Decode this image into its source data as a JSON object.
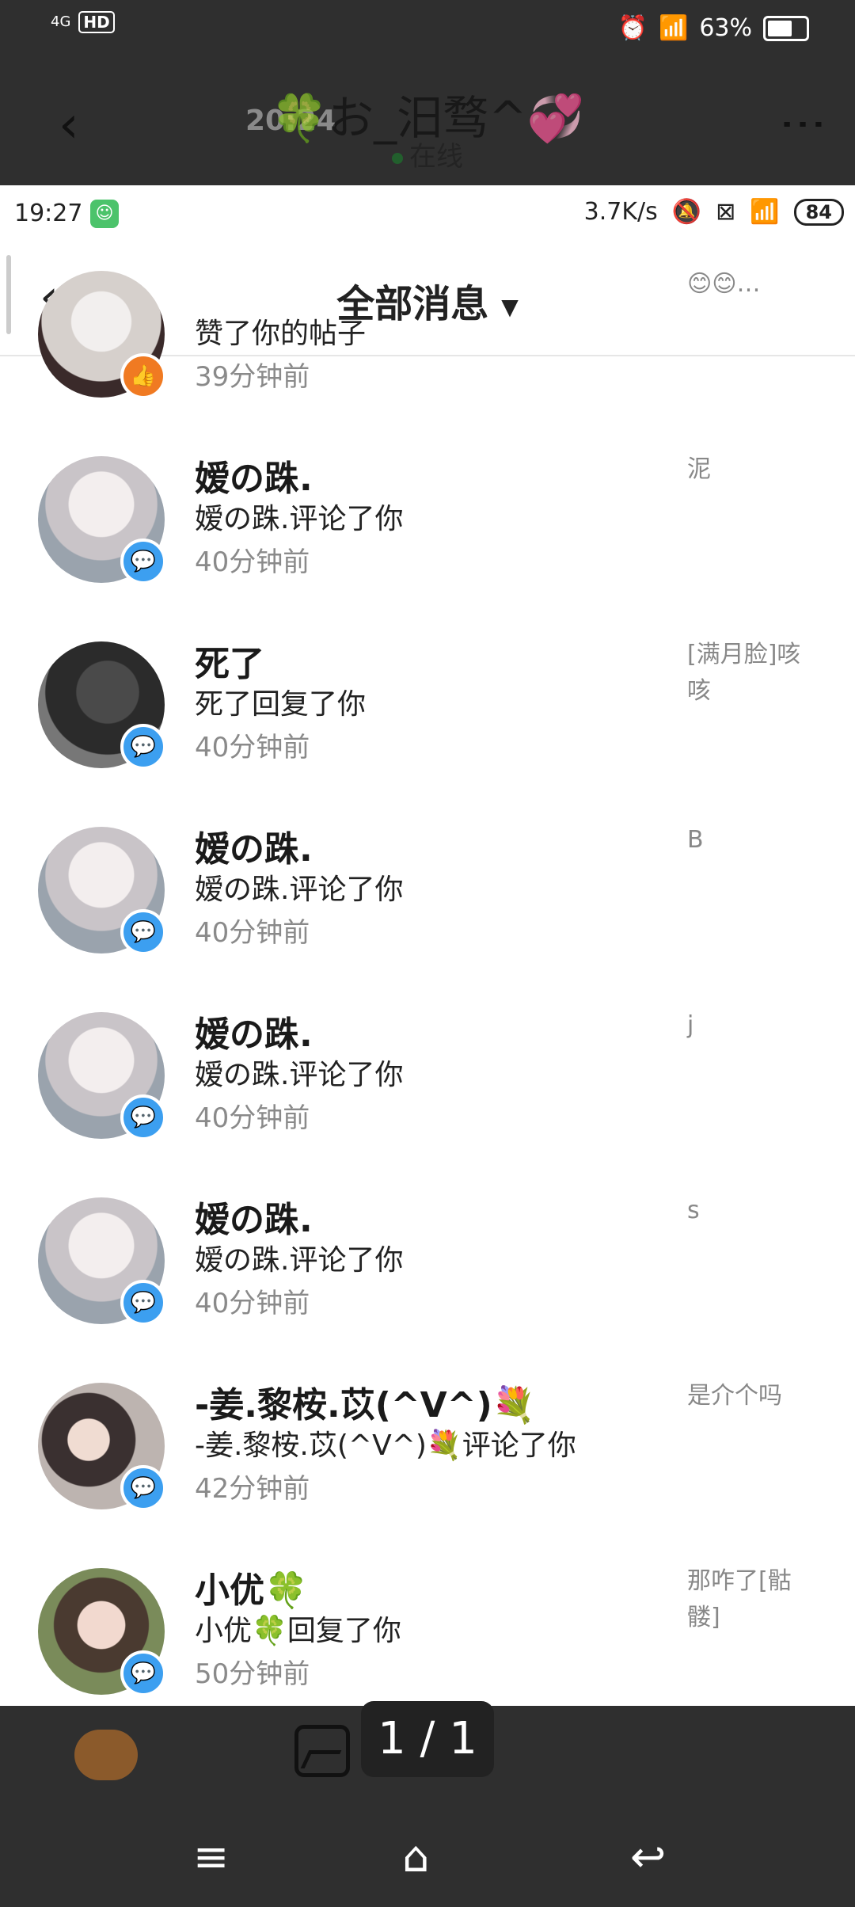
{
  "outer": {
    "status": {
      "network": "4G",
      "hd": "HD",
      "time": "20:24",
      "battery": "63%"
    },
    "header": {
      "back": "‹",
      "title": "🍀お_汨骛^💞",
      "status": "在线",
      "more": "⋮"
    }
  },
  "inner": {
    "status": {
      "time": "19:27",
      "speed": "3.7K/s",
      "battery": "84"
    },
    "header": {
      "back": "‹",
      "title": "全部消息",
      "caret": "▼"
    },
    "items": [
      {
        "name": "",
        "action": "赞了你的帖子",
        "time": "39分钟前",
        "preview": "😊😊…",
        "badge": "like"
      },
      {
        "name": "嫒の跦.",
        "action": "嫒の跦.评论了你",
        "time": "40分钟前",
        "preview": "泥",
        "badge": "comment"
      },
      {
        "name": "死了",
        "action": "死了回复了你",
        "time": "40分钟前",
        "preview": "[满月脸]咳咳",
        "badge": "comment"
      },
      {
        "name": "嫒の跦.",
        "action": "嫒の跦.评论了你",
        "time": "40分钟前",
        "preview": "B",
        "badge": "comment"
      },
      {
        "name": "嫒の跦.",
        "action": "嫒の跦.评论了你",
        "time": "40分钟前",
        "preview": "j",
        "badge": "comment"
      },
      {
        "name": "嫒の跦.",
        "action": "嫒の跦.评论了你",
        "time": "40分钟前",
        "preview": "s",
        "badge": "comment"
      },
      {
        "name": "-姜.黎桉.苡(^V^)💐",
        "action": "-姜.黎桉.苡(^V^)💐评论了你",
        "time": "42分钟前",
        "preview": "是介个吗",
        "badge": "comment"
      },
      {
        "name": "小优🍀",
        "action": "小优🍀回复了你",
        "time": "50分钟前",
        "preview": "那咋了[骷髅]",
        "badge": "comment"
      }
    ]
  },
  "viewer": {
    "counter": "1 / 1"
  },
  "nav": {
    "menu": "≡",
    "home": "⌂",
    "back": "↩"
  },
  "icons": [
    "signal-icon",
    "alarm-icon",
    "wifi-icon",
    "battery-icon",
    "mute-icon",
    "close-box-icon",
    "thumbs-up-icon",
    "comment-icon",
    "gallery-icon"
  ],
  "colors": {
    "accent_blue": "#3c9ff0",
    "like_orange": "#f07a22"
  }
}
